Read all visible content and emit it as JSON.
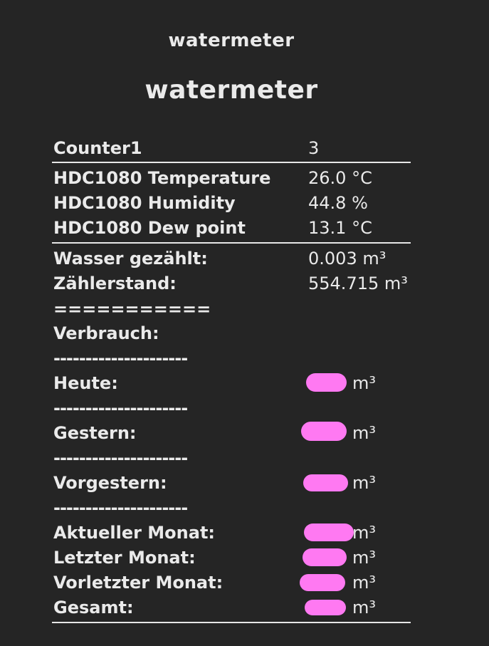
{
  "header": {
    "title": "watermeter"
  },
  "page": {
    "title": "watermeter"
  },
  "sensors": {
    "counter": {
      "label": "Counter1",
      "value": "3"
    },
    "temperature": {
      "label": "HDC1080 Temperature",
      "value": "26.0 °C"
    },
    "humidity": {
      "label": "HDC1080 Humidity",
      "value": "44.8 %"
    },
    "dewpoint": {
      "label": "HDC1080 Dew point",
      "value": "13.1 °C"
    },
    "water_counted": {
      "label": "Wasser gezählt:",
      "value": "0.003 m³"
    },
    "meter_reading": {
      "label": "Zählerstand:",
      "value": "554.715 m³"
    }
  },
  "separators": {
    "equals": "===========",
    "dashes": "---------------------"
  },
  "consumption": {
    "title": "Verbrauch:",
    "unit": "m³",
    "redaction_color": "#ff79f2",
    "items": [
      {
        "label": "Heute:"
      },
      {
        "label": "Gestern:"
      },
      {
        "label": "Vorgestern:"
      },
      {
        "label": "Aktueller Monat:"
      },
      {
        "label": "Letzter Monat:"
      },
      {
        "label": "Vorletzter Monat:"
      },
      {
        "label": "Gesamt:"
      }
    ]
  }
}
